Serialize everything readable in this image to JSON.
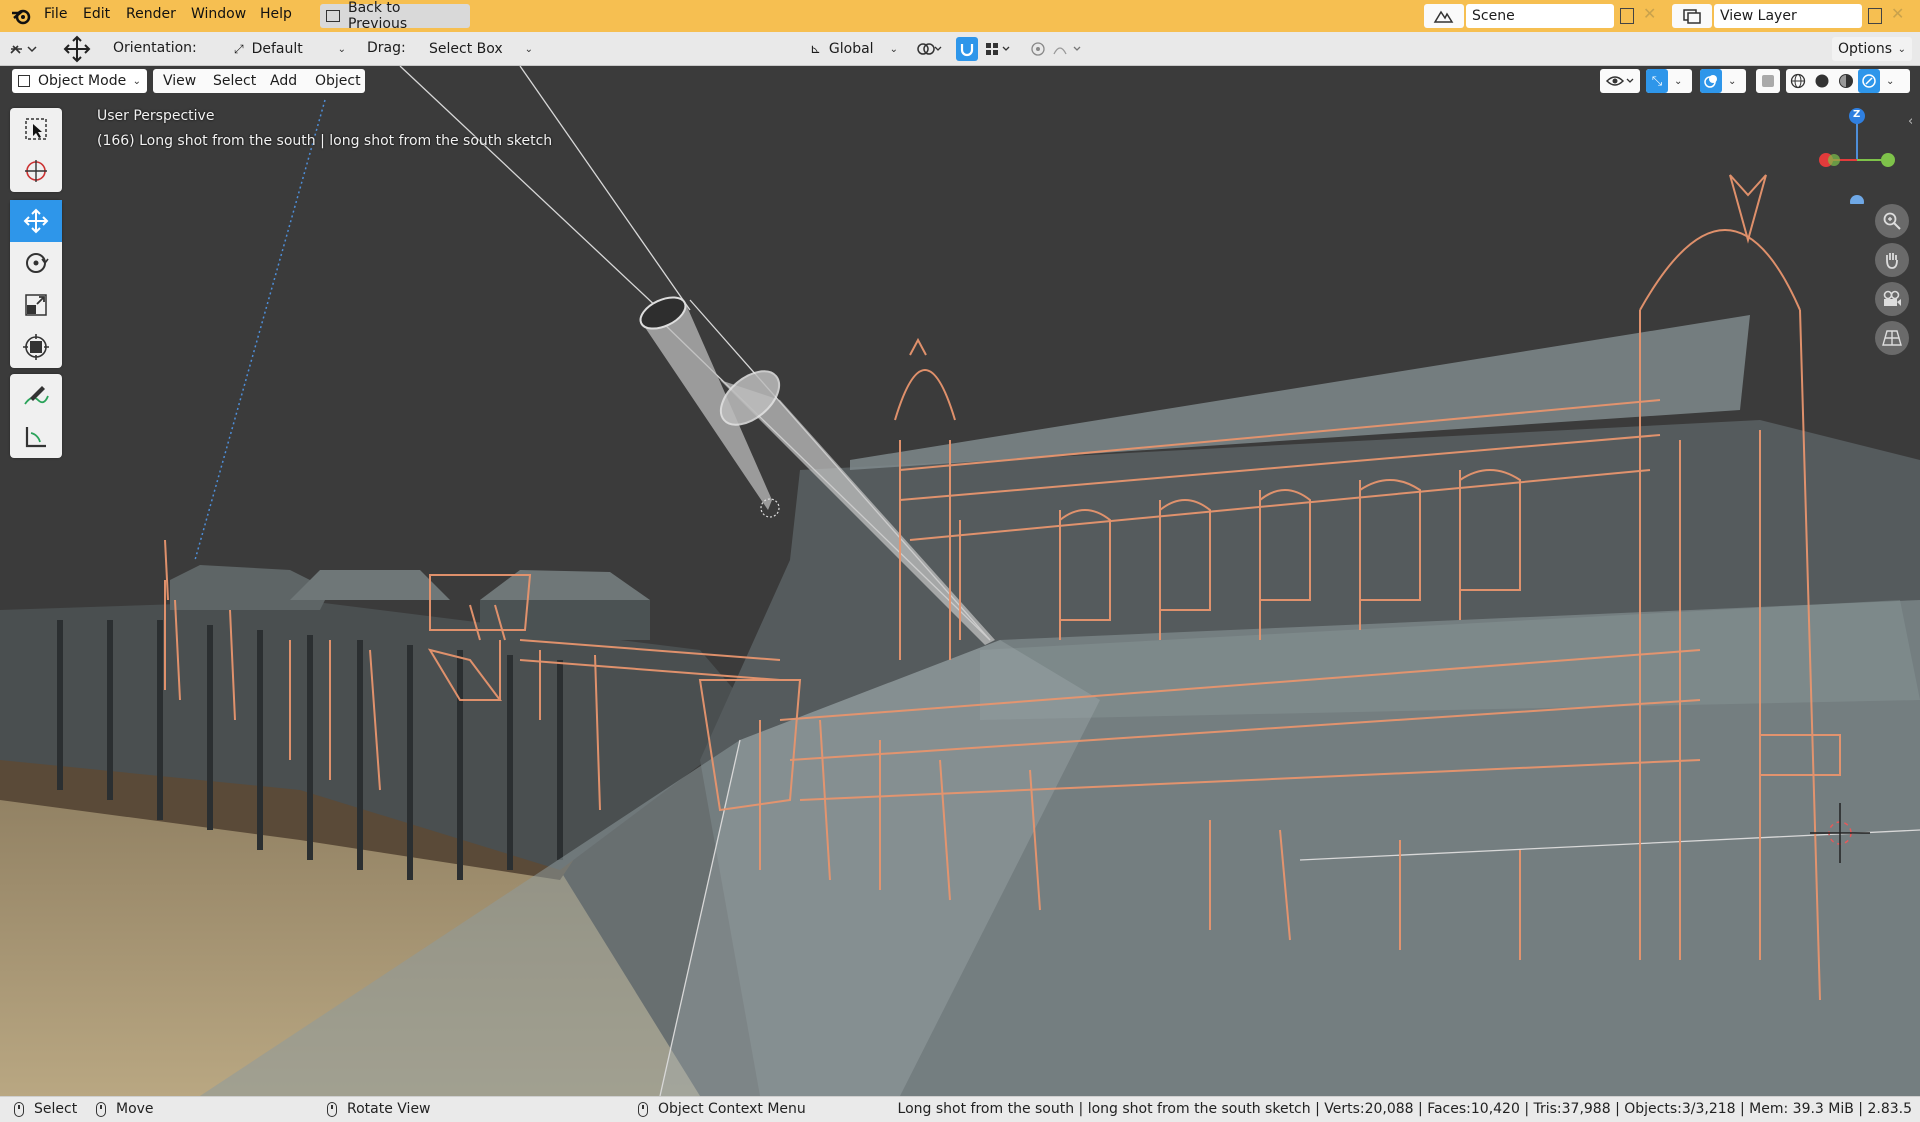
{
  "app": {
    "menus": [
      "File",
      "Edit",
      "Render",
      "Window",
      "Help"
    ],
    "back_button": "Back to Previous",
    "scene": "Scene",
    "view_layer": "View Layer"
  },
  "tool_header": {
    "orientation_label": "Orientation:",
    "orientation_value": "Default",
    "drag_label": "Drag:",
    "drag_value": "Select Box",
    "transform_orientation": "Global",
    "options_label": "Options"
  },
  "viewport_header": {
    "mode": "Object Mode",
    "menus": [
      "View",
      "Select",
      "Add",
      "Object"
    ]
  },
  "viewport": {
    "perspective": "User Perspective",
    "object_info": "(166) Long shot from the south | long shot from the south sketch",
    "gizmo_axis_z": "Z"
  },
  "toolbar": {
    "tools": [
      "select-box-icon",
      "cursor-icon",
      "move-icon",
      "rotate-icon",
      "scale-icon",
      "transform-icon",
      "annotate-icon",
      "measure-icon"
    ],
    "active_tool": "move-icon"
  },
  "status_bar": {
    "select": "Select",
    "move": "Move",
    "rotate_view": "Rotate View",
    "context_menu": "Object Context Menu",
    "stats": "Long shot from the south | long shot from the south sketch | Verts:20,088 | Faces:10,420 | Tris:37,988 | Objects:3/3,218 | Mem: 39.3 MiB | 2.83.5"
  },
  "colors": {
    "topbar": "#f6bf51",
    "active_tool": "#2e96ea",
    "sketch_lines": "#e8956e",
    "viewport_bg": "#3a3a3a"
  }
}
